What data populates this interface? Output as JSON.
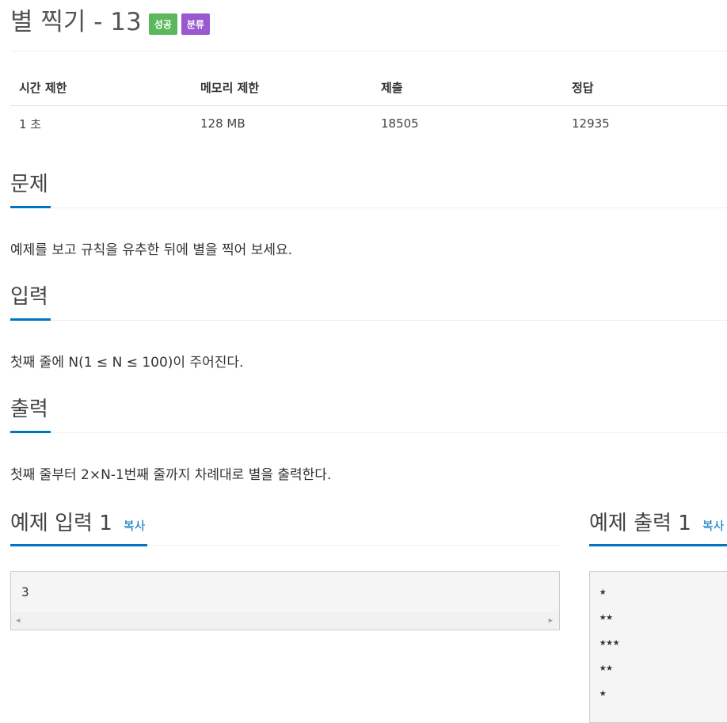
{
  "problem": {
    "title": "별 찍기 - 13",
    "badges": {
      "success": "성공",
      "category": "분류"
    }
  },
  "info_table": {
    "headers": [
      "시간 제한",
      "메모리 제한",
      "제출",
      "정답"
    ],
    "values": [
      "1 초",
      "128 MB",
      "18505",
      "12935"
    ]
  },
  "sections": {
    "problem": {
      "heading": "문제",
      "text": "예제를 보고 규칙을 유추한 뒤에 별을 찍어 보세요."
    },
    "input": {
      "heading": "입력",
      "text": "첫째 줄에 N(1 ≤ N ≤ 100)이 주어진다."
    },
    "output": {
      "heading": "출력",
      "text": "첫째 줄부터 2×N-1번째 줄까지 차례대로 별을 출력한다."
    }
  },
  "samples": {
    "input": {
      "heading": "예제 입력 1",
      "copy_label": "복사",
      "content": "3"
    },
    "output": {
      "heading": "예제 출력 1",
      "copy_label": "복사",
      "lines": [
        "★",
        "★★",
        "★★★",
        "★★",
        "★"
      ]
    }
  },
  "colors": {
    "accent": "#0076c0",
    "success": "#5cb85c",
    "category": "#9b59d0"
  }
}
